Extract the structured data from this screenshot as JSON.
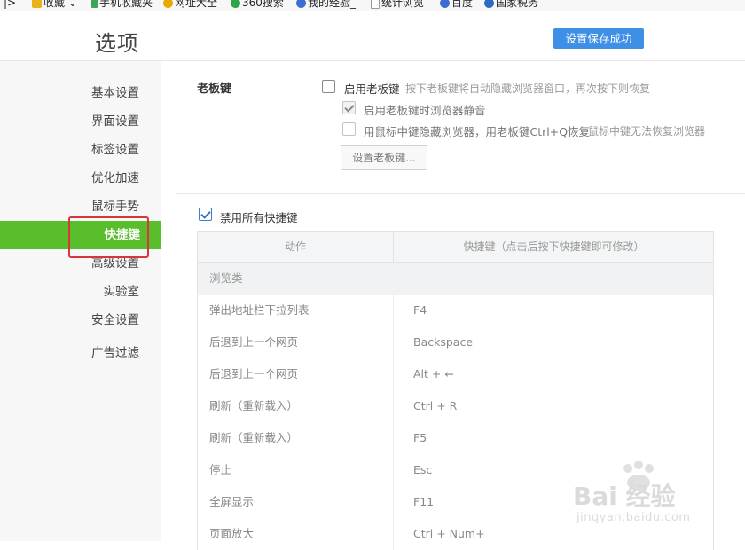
{
  "bookmarks": {
    "toggle": "|>",
    "items": [
      {
        "label": "收藏",
        "icon": "star-icon",
        "color": "#e8b21c",
        "has_dropdown": true
      },
      {
        "label": "手机收藏夹",
        "icon": "phone-icon",
        "color": "#3aa657"
      },
      {
        "label": "网址大全",
        "icon": "plus-circle-icon",
        "color": "#e6a900"
      },
      {
        "label": "360搜索",
        "icon": "search-360-icon",
        "color": "#2fa54a"
      },
      {
        "label": "我的经验_",
        "icon": "paw-icon",
        "color": "#3b6fcf"
      },
      {
        "label": "统计浏览",
        "icon": "page-icon",
        "color": "#9a9a9a"
      },
      {
        "label": "百度",
        "icon": "paw-icon",
        "color": "#3b6fcf"
      },
      {
        "label": "国家税务",
        "icon": "globe-icon",
        "color": "#2f6ac2"
      }
    ]
  },
  "header": {
    "title": "选项",
    "save_status": "设置保存成功",
    "save_color": "#3e8fe6"
  },
  "sidebar": {
    "active_color": "#58be2c",
    "items": [
      {
        "label": "基本设置"
      },
      {
        "label": "界面设置"
      },
      {
        "label": "标签设置"
      },
      {
        "label": "优化加速"
      },
      {
        "label": "鼠标手势"
      },
      {
        "label": "快捷键",
        "active": true
      },
      {
        "label": "高级设置"
      },
      {
        "label": "实验室"
      },
      {
        "label": "安全设置"
      },
      {
        "label": "广告过滤"
      }
    ]
  },
  "boss_key": {
    "section_label": "老板键",
    "enable": {
      "label": "启用老板键",
      "hint": "按下老板键将自动隐藏浏览器窗口，再次按下则恢复",
      "checked": false
    },
    "mute": {
      "label": "启用老板键时浏览器静音",
      "checked": true,
      "disabled": true
    },
    "middle_click": {
      "label": "用鼠标中键隐藏浏览器，用老板键Ctrl+Q恢复",
      "hint": "鼠标中键无法恢复浏览器",
      "checked": false,
      "disabled": true
    },
    "set_button": "设置老板键..."
  },
  "shortcuts": {
    "disable_all": {
      "label": "禁用所有快捷键",
      "checked": true
    },
    "columns": {
      "action": "动作",
      "shortcut": "快捷键（点击后按下快捷键即可修改）"
    },
    "group": "浏览类",
    "rows": [
      {
        "action": "弹出地址栏下拉列表",
        "key": "F4"
      },
      {
        "action": "后退到上一个网页",
        "key": "Backspace"
      },
      {
        "action": "后退到上一个网页",
        "key": "Alt + ←"
      },
      {
        "action": "刷新（重新载入）",
        "key": "Ctrl + R"
      },
      {
        "action": "刷新（重新载入）",
        "key": "F5"
      },
      {
        "action": "停止",
        "key": "Esc"
      },
      {
        "action": "全屏显示",
        "key": "F11"
      },
      {
        "action": "页面放大",
        "key": "Ctrl + Num+"
      }
    ]
  },
  "watermark": {
    "brand": "Bai 经验",
    "url": "jingyan.baidu.com"
  }
}
